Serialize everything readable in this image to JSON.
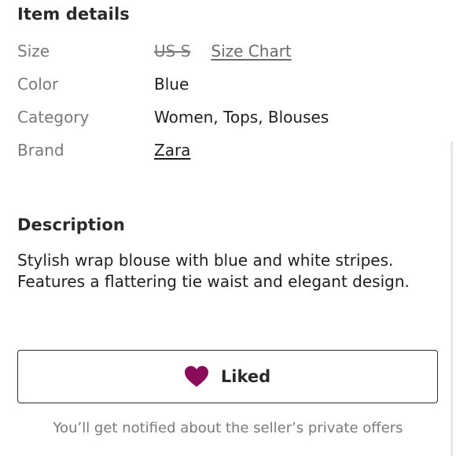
{
  "item_details": {
    "title": "Item details",
    "rows": [
      {
        "label": "Size",
        "value": "US S",
        "link": "Size Chart"
      },
      {
        "label": "Color",
        "value": "Blue"
      },
      {
        "label": "Category",
        "value": "Women, Tops, Blouses"
      },
      {
        "label": "Brand",
        "value": "Zara"
      }
    ]
  },
  "description": {
    "title": "Description",
    "lines": [
      "Stylish wrap blouse with blue and white stripes.",
      "Features a flattering tie waist and elegant design."
    ]
  },
  "like_button": {
    "label": "Liked",
    "icon": "heart-icon",
    "heart_color": "#8a0b5a"
  },
  "notice": "You’ll get notified about the seller’s private offers"
}
